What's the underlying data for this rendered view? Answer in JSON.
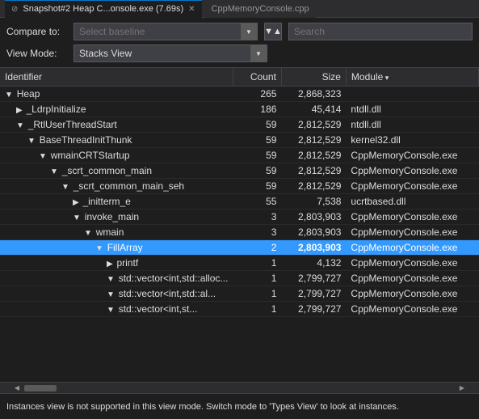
{
  "titlebar": {
    "tab1_label": "Snapshot#2 Heap C...onsole.exe (7.69s)",
    "tab1_pin": "⊘",
    "tab2_label": "CppMemoryConsole.cpp",
    "close": "✕"
  },
  "toolbar": {
    "compare_label": "Compare to:",
    "compare_placeholder": "Select baseline",
    "viewmode_label": "View Mode:",
    "viewmode_value": "Stacks View",
    "search_placeholder": "Search",
    "filter_icon": "▼"
  },
  "table": {
    "columns": [
      "Identifier",
      "Count",
      "Size",
      "Module"
    ],
    "rows": [
      {
        "indent": 0,
        "icon": "▲",
        "name": "Heap",
        "count": "265",
        "size": "2,868,323",
        "module": ""
      },
      {
        "indent": 1,
        "icon": "▶",
        "name": "_LdrpInitialize",
        "count": "186",
        "size": "45,414",
        "module": "ntdll.dll"
      },
      {
        "indent": 1,
        "icon": "▲",
        "name": "_RtlUserThreadStart",
        "count": "59",
        "size": "2,812,529",
        "module": "ntdll.dll"
      },
      {
        "indent": 2,
        "icon": "▲",
        "name": "BaseThreadInitThunk",
        "count": "59",
        "size": "2,812,529",
        "module": "kernel32.dll"
      },
      {
        "indent": 3,
        "icon": "▲",
        "name": "wmainCRTStartup",
        "count": "59",
        "size": "2,812,529",
        "module": "CppMemoryConsole.exe"
      },
      {
        "indent": 4,
        "icon": "▲",
        "name": "_scrt_common_main",
        "count": "59",
        "size": "2,812,529",
        "module": "CppMemoryConsole.exe"
      },
      {
        "indent": 5,
        "icon": "▲",
        "name": "_scrt_common_main_seh",
        "count": "59",
        "size": "2,812,529",
        "module": "CppMemoryConsole.exe"
      },
      {
        "indent": 6,
        "icon": "▶",
        "name": "_initterm_e",
        "count": "55",
        "size": "7,538",
        "module": "ucrtbased.dll"
      },
      {
        "indent": 6,
        "icon": "▲",
        "name": "invoke_main",
        "count": "3",
        "size": "2,803,903",
        "module": "CppMemoryConsole.exe"
      },
      {
        "indent": 7,
        "icon": "▲",
        "name": "wmain",
        "count": "3",
        "size": "2,803,903",
        "module": "CppMemoryConsole.exe"
      },
      {
        "indent": 8,
        "icon": "▲",
        "name": "FillArray",
        "count": "2",
        "size": "2,803,903",
        "module": "CppMemoryConsole.exe",
        "selected": true
      },
      {
        "indent": 9,
        "icon": "▶",
        "name": "printf",
        "count": "1",
        "size": "4,132",
        "module": "CppMemoryConsole.exe"
      },
      {
        "indent": 9,
        "icon": "▲",
        "name": "std::vector<int,std::alloc...",
        "count": "1",
        "size": "2,799,727",
        "module": "CppMemoryConsole.exe"
      },
      {
        "indent": 9,
        "icon": "▲",
        "name": "std::vector<int,std::al...",
        "count": "1",
        "size": "2,799,727",
        "module": "CppMemoryConsole.exe"
      },
      {
        "indent": 9,
        "icon": "▲",
        "name": "std::vector<int,st...",
        "count": "1",
        "size": "2,799,727",
        "module": "CppMemoryConsole.exe"
      }
    ]
  },
  "status": {
    "message": "Instances view is not supported in this view mode. Switch mode to 'Types View' to look at instances."
  }
}
